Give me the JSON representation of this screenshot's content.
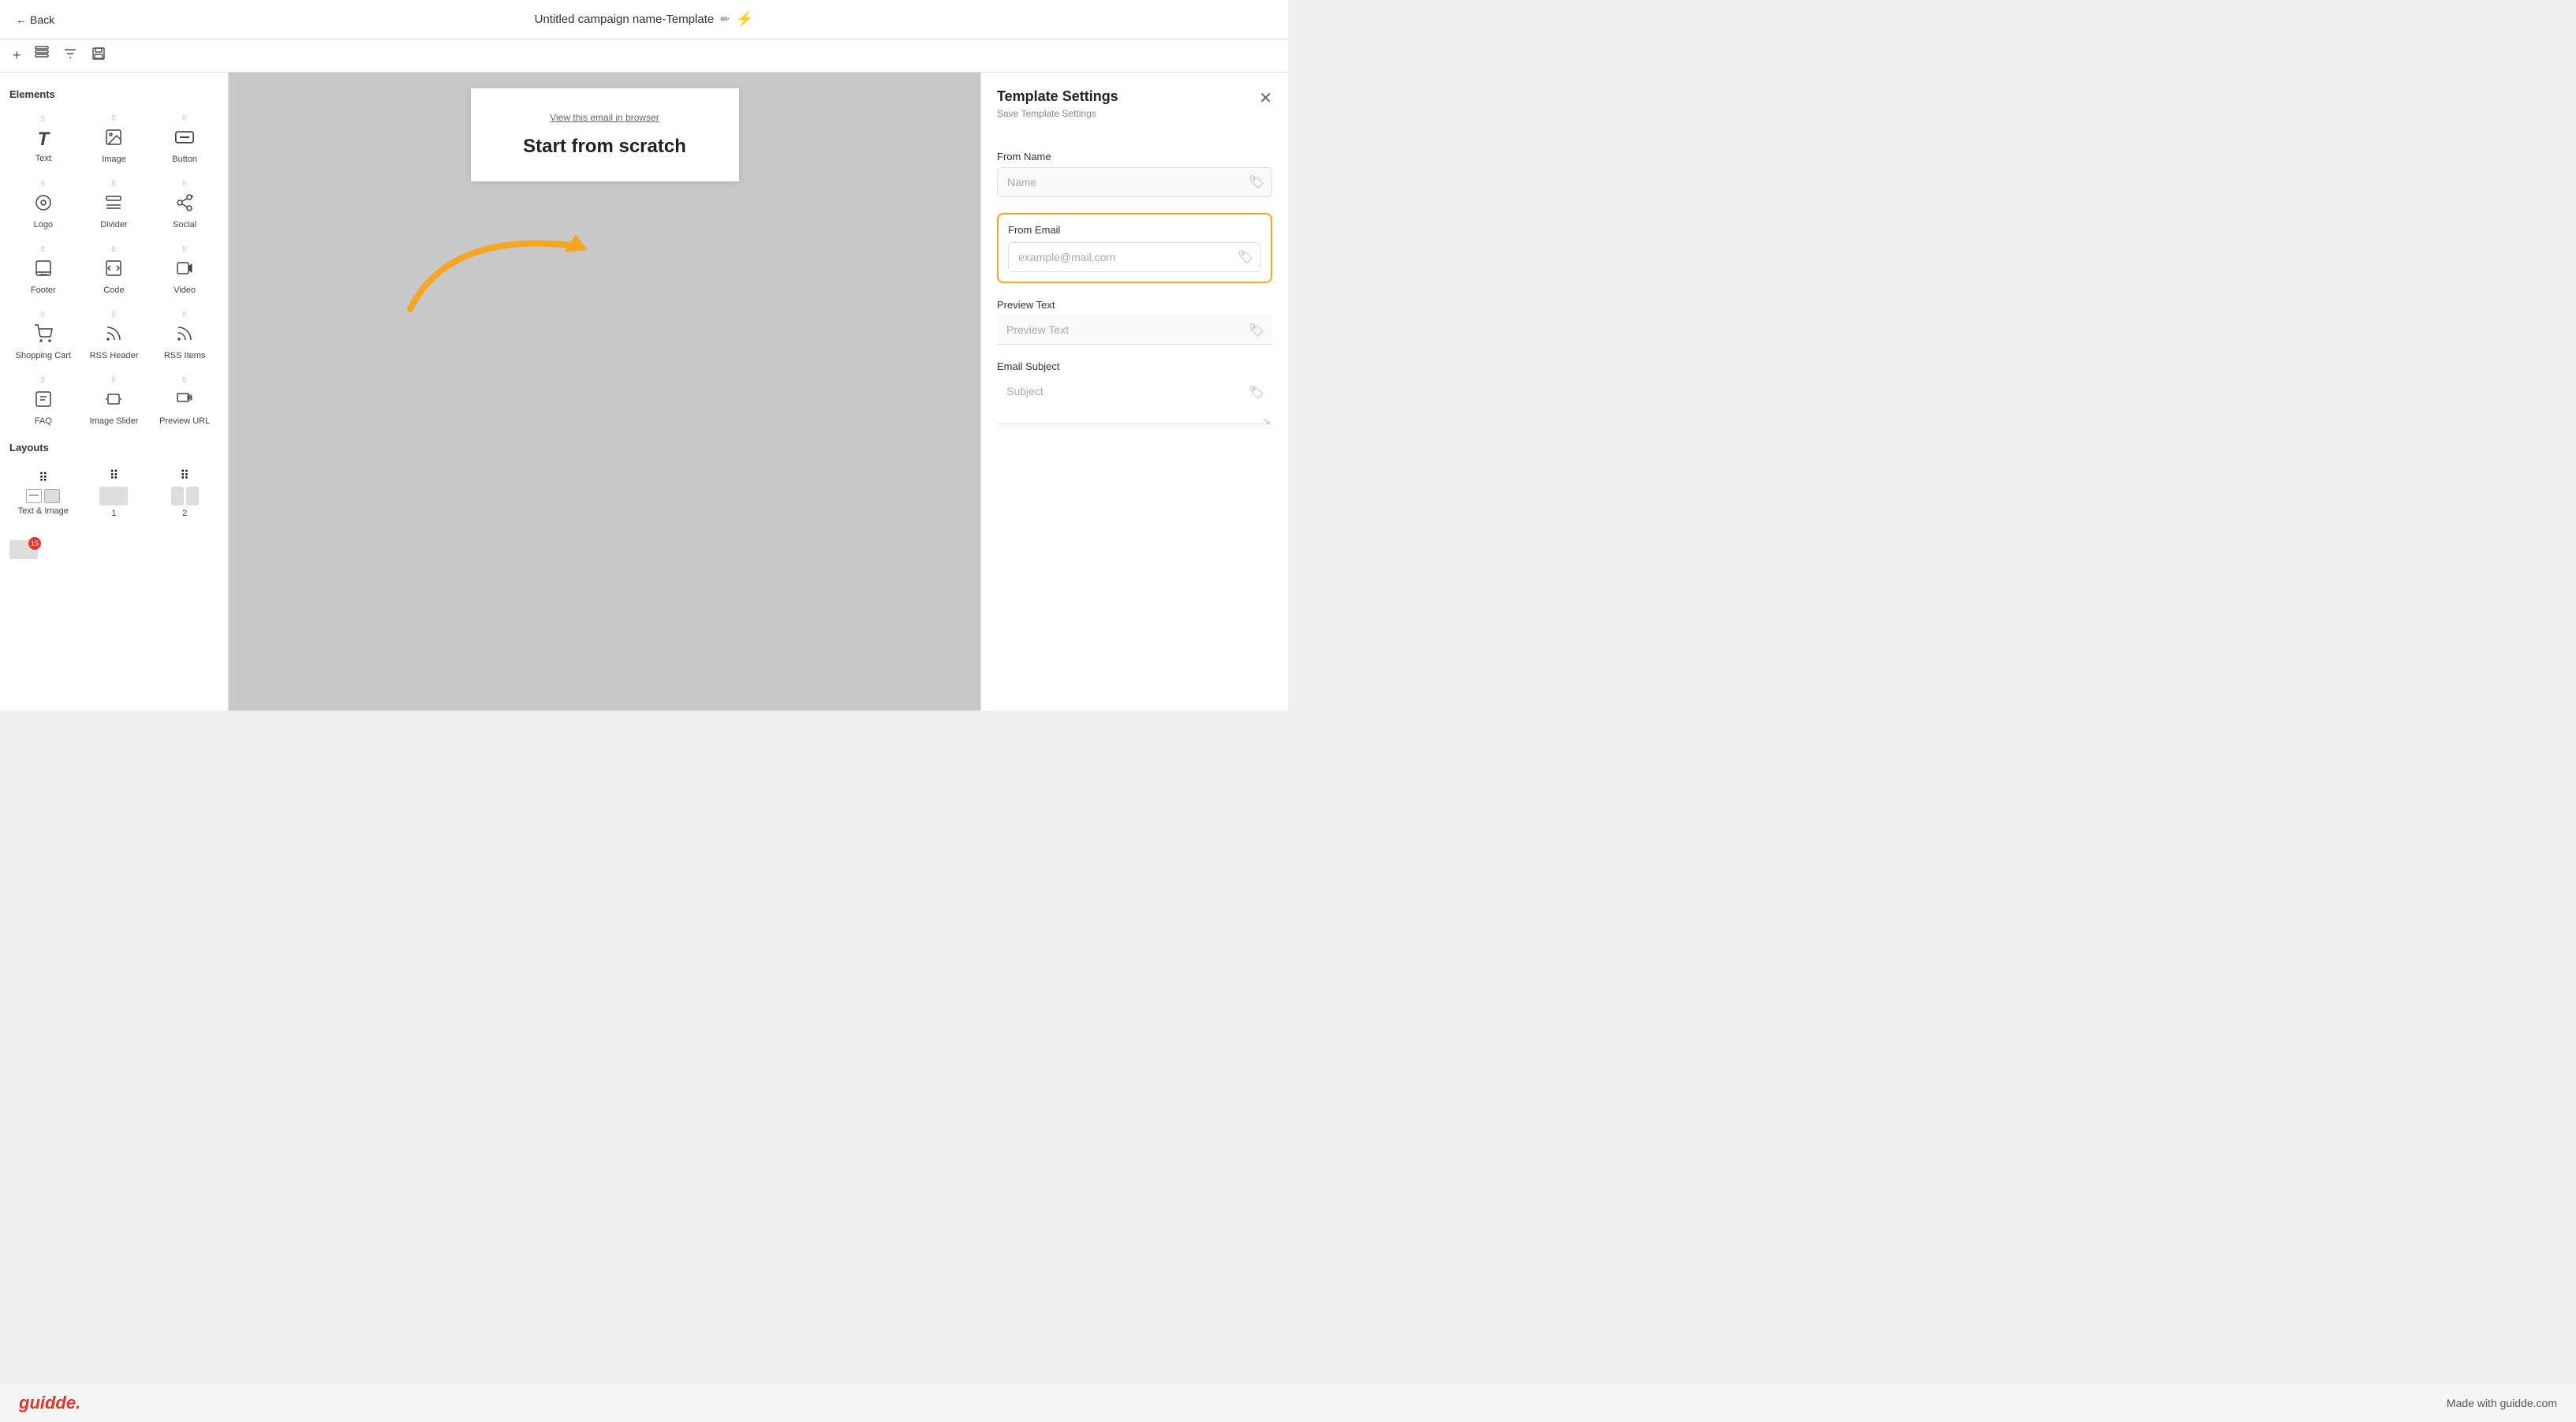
{
  "header": {
    "back_label": "Back",
    "campaign_title": "Untitled campaign name-Template",
    "edit_icon": "✏",
    "lightning": "⚡"
  },
  "toolbar": {
    "add_icon": "+",
    "layers_icon": "⊞",
    "filter_icon": "⇅",
    "save_icon": "💾"
  },
  "sidebar": {
    "elements_title": "Elements",
    "items": [
      {
        "id": "text",
        "label": "Text",
        "icon": "T"
      },
      {
        "id": "image",
        "label": "Image",
        "icon": "🖼"
      },
      {
        "id": "button",
        "label": "Button",
        "icon": "—"
      },
      {
        "id": "logo",
        "label": "Logo",
        "icon": "◎"
      },
      {
        "id": "divider",
        "label": "Divider",
        "icon": "÷"
      },
      {
        "id": "social",
        "label": "Social",
        "icon": "📣"
      },
      {
        "id": "footer",
        "label": "Footer",
        "icon": "☰"
      },
      {
        "id": "code",
        "label": "Code",
        "icon": "<>"
      },
      {
        "id": "video",
        "label": "Video",
        "icon": "▶"
      },
      {
        "id": "shopping-cart",
        "label": "Shopping Cart",
        "icon": "🛒"
      },
      {
        "id": "rss-header",
        "label": "RSS Header",
        "icon": "RSS"
      },
      {
        "id": "rss-items",
        "label": "RSS Items",
        "icon": "RSS"
      },
      {
        "id": "faq",
        "label": "FAQ",
        "icon": "FAQ"
      },
      {
        "id": "image-slider",
        "label": "Image Slider",
        "icon": "⇄"
      },
      {
        "id": "preview-url",
        "label": "Preview URL",
        "icon": "⟨⊞⟩"
      }
    ],
    "layouts_title": "Layouts",
    "layout_items": [
      {
        "id": "text-image",
        "label": "Text & Image"
      },
      {
        "id": "one",
        "label": "1"
      },
      {
        "id": "two",
        "label": "2"
      }
    ]
  },
  "canvas": {
    "view_link": "View this email in browser",
    "scratch_title": "Start from scratch"
  },
  "settings": {
    "title": "Template Settings",
    "subtitle": "Save Template Settings",
    "from_name_label": "From Name",
    "from_name_placeholder": "Name",
    "from_email_label": "From Email",
    "from_email_placeholder": "example@mail.com",
    "preview_text_label": "Preview Text",
    "preview_text_placeholder": "Preview Text",
    "email_subject_label": "Email Subject",
    "email_subject_placeholder": "Subject"
  },
  "bottom_bar": {
    "logo": "guidde.",
    "made_with": "Made with guidde.com"
  }
}
